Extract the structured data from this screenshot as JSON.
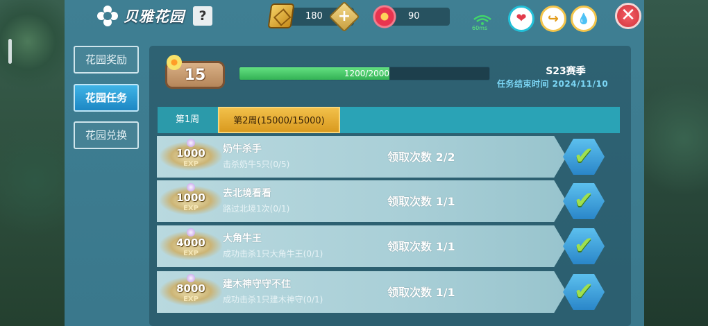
{
  "header": {
    "title": "贝雅花园",
    "help_label": "?",
    "gold_amount": "180",
    "gem_amount": "90",
    "plus_label": "+",
    "ping_label": "60ms",
    "close_label": "✕"
  },
  "sidebar": {
    "items": [
      {
        "label": "花园奖励",
        "active": false
      },
      {
        "label": "花园任务",
        "active": true
      },
      {
        "label": "花园兑换",
        "active": false
      }
    ]
  },
  "level": {
    "value": "15",
    "progress_text": "1200/2000",
    "progress_fraction": 0.6
  },
  "season": {
    "name": "S23赛季",
    "end_label": "任务结束时间 2024/11/10"
  },
  "weeks": [
    {
      "label": "第1周",
      "active": false
    },
    {
      "label": "第2周(15000/15000)",
      "active": true
    }
  ],
  "tasks": [
    {
      "exp": "1000",
      "exp_label": "EXP",
      "name": "奶牛杀手",
      "desc": "击杀奶牛5只(0/5)",
      "claim": "领取次数 2/2"
    },
    {
      "exp": "1000",
      "exp_label": "EXP",
      "name": "去北境看看",
      "desc": "路过北境1次(0/1)",
      "claim": "领取次数 1/1"
    },
    {
      "exp": "4000",
      "exp_label": "EXP",
      "name": "大角牛王",
      "desc": "成功击杀1只大角牛王(0/1)",
      "claim": "领取次数 1/1"
    },
    {
      "exp": "8000",
      "exp_label": "EXP",
      "name": "建木神守守不住",
      "desc": "成功击杀1只建木神守(0/1)",
      "claim": "领取次数 1/1"
    }
  ],
  "colors": {
    "panel": "#3f7f93",
    "progress_fill": "#34b255",
    "active_week": "#f2c04a",
    "active_tab": "#1d87c4"
  },
  "icons": [
    "flower-icon",
    "help-icon",
    "gold-icon",
    "plus-icon",
    "gem-icon",
    "wifi-icon",
    "heart-icon",
    "swap-icon",
    "drop-icon",
    "close-icon",
    "check-icon"
  ]
}
